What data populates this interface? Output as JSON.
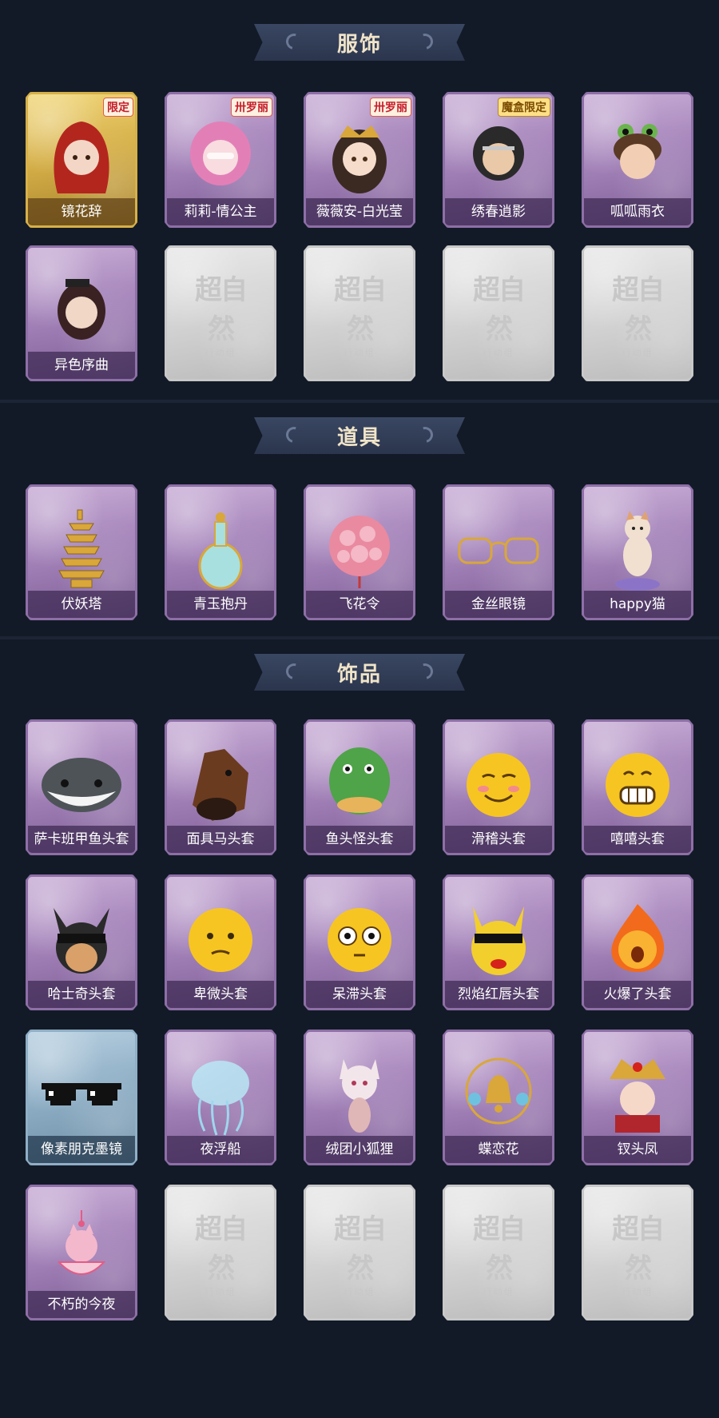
{
  "sections": [
    {
      "title": "服饰",
      "cards": [
        {
          "label": "镜花辞",
          "tag": "限定",
          "tag_style": "red",
          "variant": "gold",
          "icon": "red-hood-girl"
        },
        {
          "label": "莉莉-情公主",
          "tag": "卅罗丽",
          "tag_style": "red",
          "variant": "purple",
          "icon": "pink-hair-girl"
        },
        {
          "label": "薇薇安-白光莹",
          "tag": "卅罗丽",
          "tag_style": "red",
          "variant": "purple",
          "icon": "golden-crown-girl"
        },
        {
          "label": "绣春逍影",
          "tag": "魔盒限定",
          "tag_style": "gold",
          "variant": "purple",
          "icon": "swordsman"
        },
        {
          "label": "呱呱雨衣",
          "tag": "",
          "tag_style": "",
          "variant": "purple",
          "icon": "frog-hat-girl"
        },
        {
          "label": "异色序曲",
          "tag": "",
          "tag_style": "",
          "variant": "purple",
          "icon": "gothic-girl"
        },
        {
          "label": "",
          "tag": "",
          "tag_style": "",
          "variant": "empty",
          "icon": "placeholder"
        },
        {
          "label": "",
          "tag": "",
          "tag_style": "",
          "variant": "empty",
          "icon": "placeholder"
        },
        {
          "label": "",
          "tag": "",
          "tag_style": "",
          "variant": "empty",
          "icon": "placeholder"
        },
        {
          "label": "",
          "tag": "",
          "tag_style": "",
          "variant": "empty",
          "icon": "placeholder"
        }
      ]
    },
    {
      "title": "道具",
      "cards": [
        {
          "label": "伏妖塔",
          "variant": "purple",
          "icon": "pagoda"
        },
        {
          "label": "青玉抱丹",
          "variant": "purple",
          "icon": "jade-vase"
        },
        {
          "label": "飞花令",
          "variant": "purple",
          "icon": "flower-ball"
        },
        {
          "label": "金丝眼镜",
          "variant": "purple",
          "icon": "glasses"
        },
        {
          "label": "happy猫",
          "variant": "purple",
          "icon": "cat-figurine"
        }
      ]
    },
    {
      "title": "饰品",
      "cards": [
        {
          "label": "萨卡班甲鱼头套",
          "variant": "purple",
          "icon": "fish-head"
        },
        {
          "label": "面具马头套",
          "variant": "purple",
          "icon": "horse-head"
        },
        {
          "label": "鱼头怪头套",
          "variant": "purple",
          "icon": "green-fish-head"
        },
        {
          "label": "滑稽头套",
          "variant": "purple",
          "icon": "smirk-emoji"
        },
        {
          "label": "嘻嘻头套",
          "variant": "purple",
          "icon": "grin-emoji"
        },
        {
          "label": "哈士奇头套",
          "variant": "purple",
          "icon": "husky-head"
        },
        {
          "label": "卑微头套",
          "variant": "purple",
          "icon": "humble-emoji"
        },
        {
          "label": "呆滞头套",
          "variant": "purple",
          "icon": "dazed-emoji"
        },
        {
          "label": "烈焰红唇头套",
          "variant": "purple",
          "icon": "pikachu-head"
        },
        {
          "label": "火爆了头套",
          "variant": "purple",
          "icon": "fire-head"
        },
        {
          "label": "像素朋克墨镜",
          "variant": "blue",
          "icon": "pixel-sunglasses"
        },
        {
          "label": "夜浮船",
          "variant": "purple",
          "icon": "jellyfish"
        },
        {
          "label": "绒团小狐狸",
          "variant": "purple",
          "icon": "fox-plush"
        },
        {
          "label": "蝶恋花",
          "variant": "purple",
          "icon": "bell-ornament"
        },
        {
          "label": "钗头凤",
          "variant": "purple",
          "icon": "phoenix-crown"
        },
        {
          "label": "不朽的今夜",
          "variant": "purple",
          "icon": "pink-fox-bowl"
        },
        {
          "label": "",
          "variant": "empty",
          "icon": "placeholder"
        },
        {
          "label": "",
          "variant": "empty",
          "icon": "placeholder"
        },
        {
          "label": "",
          "variant": "empty",
          "icon": "placeholder"
        },
        {
          "label": "",
          "variant": "empty",
          "icon": "placeholder"
        }
      ]
    }
  ],
  "placeholder": {
    "big": "超自然",
    "small": "行动组"
  },
  "colors": {
    "background": "#141b28",
    "banner": "#2b354d",
    "banner_text": "#f0e4c8",
    "card_purple": "#a685bb",
    "card_gold": "#d6b048",
    "card_blue": "#8fafc6",
    "card_empty": "#d4d4d4"
  }
}
